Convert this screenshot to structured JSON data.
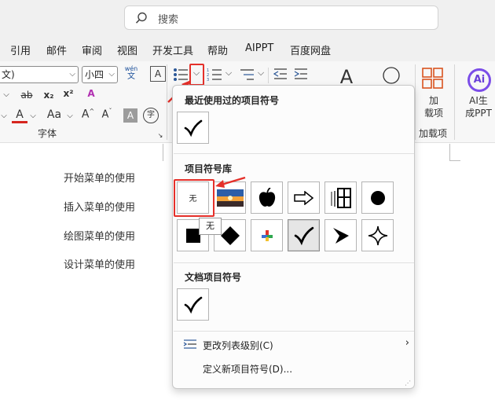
{
  "search": {
    "placeholder": "搜索"
  },
  "tabs": [
    "引用",
    "邮件",
    "审阅",
    "视图",
    "开发工具",
    "帮助",
    "AIPPT",
    "百度网盘"
  ],
  "ribbon": {
    "font_name": "文)",
    "font_size": "小四",
    "pinyin_top": "wén",
    "pinyin_bottom": "文",
    "font_group_label": "字体",
    "addins_label_1": "加",
    "addins_label_2": "载项",
    "addins_group_label": "加载项",
    "ai_label_1": "AI生",
    "ai_label_2": "成PPT",
    "ai_logo": "Ai",
    "subscript": "x₂",
    "superscript": "x²",
    "strike": "ab",
    "grow_font": "A",
    "shrink_font": "A",
    "change_case": "Aa",
    "font_color": "A",
    "char_shading": "A",
    "enclose_char": "字"
  },
  "document": {
    "lines": [
      "开始菜单的使用",
      "插入菜单的使用",
      "绘图菜单的使用",
      "设计菜单的使用"
    ]
  },
  "bullets_menu": {
    "recent_title": "最近使用过的项目符号",
    "library_title": "项目符号库",
    "none_label": "无",
    "document_title": "文档项目符号",
    "change_level_label": "更改列表级别(C)",
    "define_new_label": "定义新项目符号(D)...",
    "tooltip": "无"
  },
  "colors": {
    "annotation_red": "#e5302a",
    "accent_blue": "#2b5797",
    "addins_orange": "#d9541e"
  }
}
